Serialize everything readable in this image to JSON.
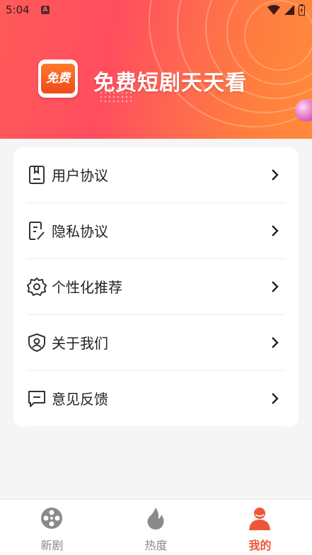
{
  "status_bar": {
    "time": "5:04",
    "notification_icon": "A"
  },
  "banner": {
    "logo_text": "免费",
    "slogan": "免费短剧天天看"
  },
  "menu": {
    "items": [
      {
        "label": "用户协议",
        "icon": "document-icon"
      },
      {
        "label": "隐私协议",
        "icon": "edit-document-icon"
      },
      {
        "label": "个性化推荐",
        "icon": "gear-icon"
      },
      {
        "label": "关于我们",
        "icon": "shield-user-icon"
      },
      {
        "label": "意见反馈",
        "icon": "message-icon"
      }
    ]
  },
  "tabbar": {
    "tabs": [
      {
        "label": "新剧",
        "icon": "film-reel-icon",
        "active": false
      },
      {
        "label": "热度",
        "icon": "flame-icon",
        "active": false
      },
      {
        "label": "我的",
        "icon": "user-icon",
        "active": true
      }
    ]
  },
  "colors": {
    "accent": "#f0553a",
    "inactive": "#8a8a8a",
    "banner_start": "#ff5a5a",
    "banner_end": "#ff8a3a"
  }
}
